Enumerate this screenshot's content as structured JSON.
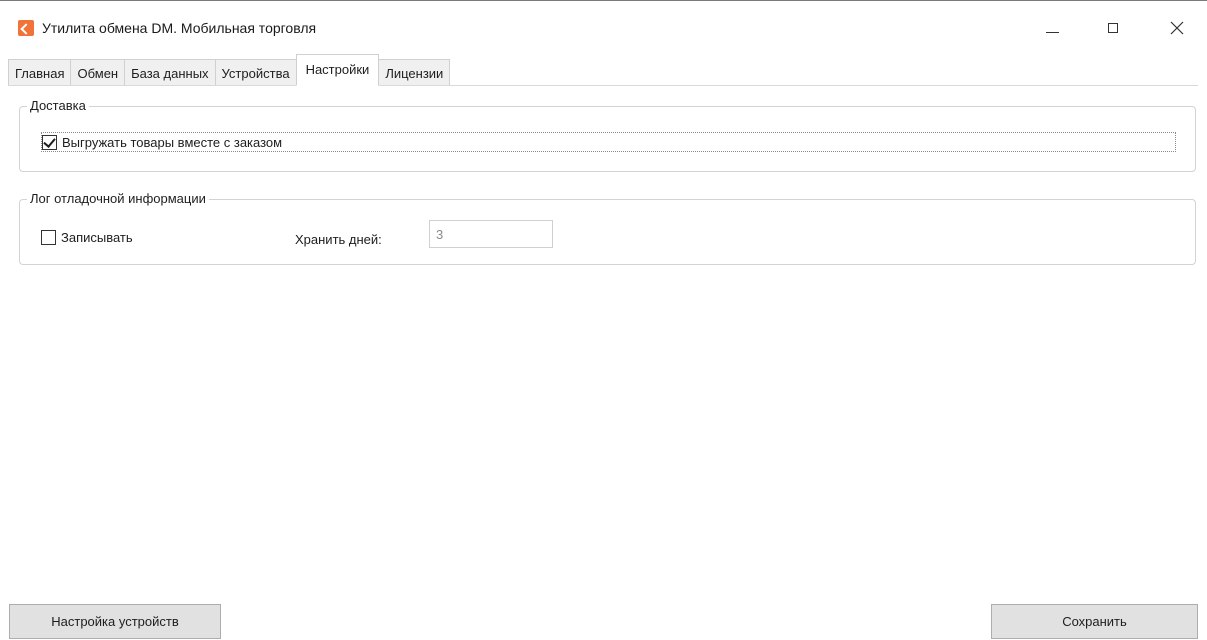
{
  "window": {
    "title": "Утилита обмена DM. Мобильная торговля",
    "icon": "app-logo-icon",
    "accent_color": "#f0733a"
  },
  "tabs": [
    {
      "label": "Главная",
      "active": false
    },
    {
      "label": "Обмен",
      "active": false
    },
    {
      "label": "База данных",
      "active": false
    },
    {
      "label": "Устройства",
      "active": false
    },
    {
      "label": "Настройки",
      "active": true
    },
    {
      "label": "Лицензии",
      "active": false
    }
  ],
  "delivery": {
    "legend": "Доставка",
    "export_goods": {
      "label": "Выгружать товары вместе с заказом",
      "checked": true
    }
  },
  "debug_log": {
    "legend": "Лог отладочной информации",
    "record": {
      "label": "Записывать",
      "checked": false
    },
    "keep_days_label": "Хранить дней:",
    "keep_days_value": "3"
  },
  "buttons": {
    "device_settings": "Настройка устройств",
    "save": "Сохранить"
  }
}
